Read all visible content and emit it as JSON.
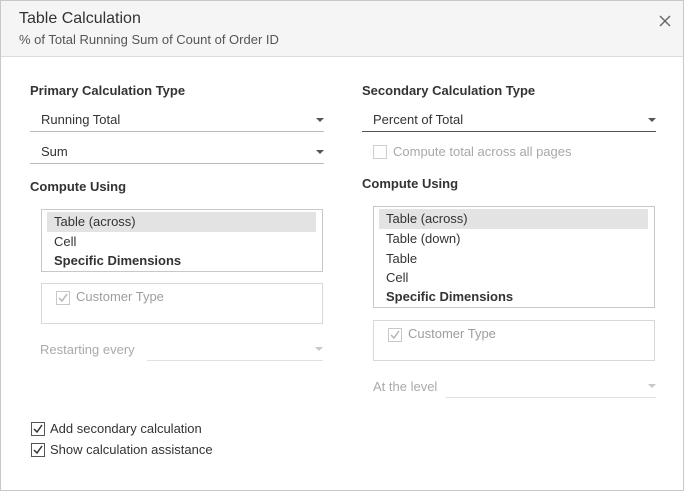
{
  "dialog": {
    "title": "Table Calculation",
    "subtitle": "% of Total Running Sum of Count of Order ID",
    "close_icon": "close-icon"
  },
  "primary": {
    "heading": "Primary Calculation Type",
    "type_value": "Running Total",
    "aggregation_value": "Sum",
    "compute_heading": "Compute Using",
    "compute_items": [
      "Table (across)",
      "Cell",
      "Specific Dimensions"
    ],
    "selected_index": 0,
    "dimension_label": "Customer Type",
    "dimension_checked": true,
    "restarting_label": "Restarting every",
    "restarting_value": ""
  },
  "secondary": {
    "heading": "Secondary Calculation Type",
    "type_value": "Percent of Total",
    "compute_total_label": "Compute total across all pages",
    "compute_total_checked": false,
    "compute_heading": "Compute Using",
    "compute_items": [
      "Table (across)",
      "Table (down)",
      "Table",
      "Cell",
      "Specific Dimensions"
    ],
    "selected_index": 0,
    "dimension_label": "Customer Type",
    "dimension_checked": true,
    "level_label": "At the level",
    "level_value": ""
  },
  "options": {
    "add_secondary_label": "Add secondary calculation",
    "add_secondary_checked": true,
    "show_assistance_label": "Show calculation assistance",
    "show_assistance_checked": true
  },
  "colors": {
    "header_bg": "#f5f5f5",
    "selected_item_bg": "#e3e3e3",
    "disabled_text": "#aaaaaa"
  }
}
